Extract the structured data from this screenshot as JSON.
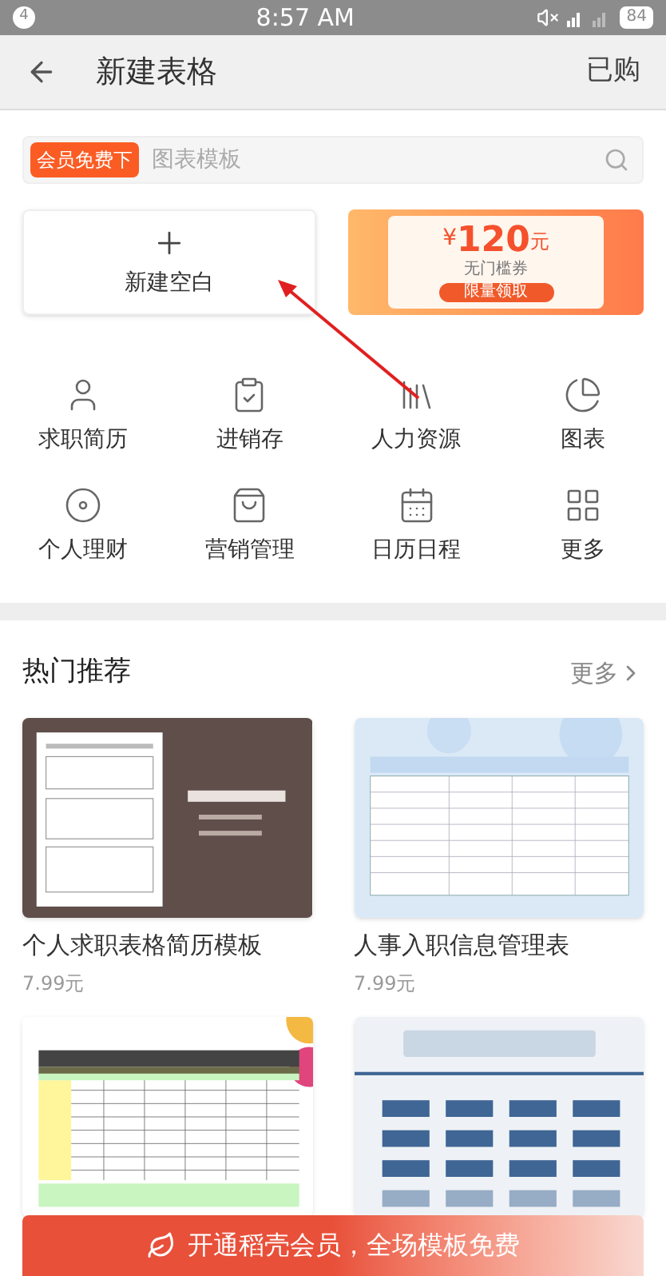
{
  "status_bar": {
    "notification_count": "4",
    "time": "8:57 AM",
    "battery": "84"
  },
  "header": {
    "title": "新建表格",
    "action": "已购"
  },
  "search": {
    "badge": "会员免费下",
    "placeholder": "图表模板"
  },
  "new_blank": {
    "label": "新建空白"
  },
  "promo": {
    "currency": "¥",
    "amount": "120",
    "unit": "元",
    "caption": "无门槛券",
    "button": "限量领取"
  },
  "categories": [
    {
      "kind": "resume",
      "label": "求职简历"
    },
    {
      "kind": "inventory",
      "label": "进销存"
    },
    {
      "kind": "hr",
      "label": "人力资源"
    },
    {
      "kind": "chart",
      "label": "图表"
    },
    {
      "kind": "finance",
      "label": "个人理财"
    },
    {
      "kind": "marketing",
      "label": "营销管理"
    },
    {
      "kind": "calendar",
      "label": "日历日程"
    },
    {
      "kind": "more",
      "label": "更多"
    }
  ],
  "hot": {
    "title": "热门推荐",
    "more": "更多"
  },
  "templates": [
    {
      "kind": "resume",
      "title": "个人求职表格简历模板",
      "price": "7.99元"
    },
    {
      "kind": "sheet",
      "title": "人事入职信息管理表",
      "price": "7.99元"
    },
    {
      "kind": "ledger"
    },
    {
      "kind": "system"
    }
  ],
  "banner": {
    "text": "开通稻壳会员，全场模板免费"
  }
}
